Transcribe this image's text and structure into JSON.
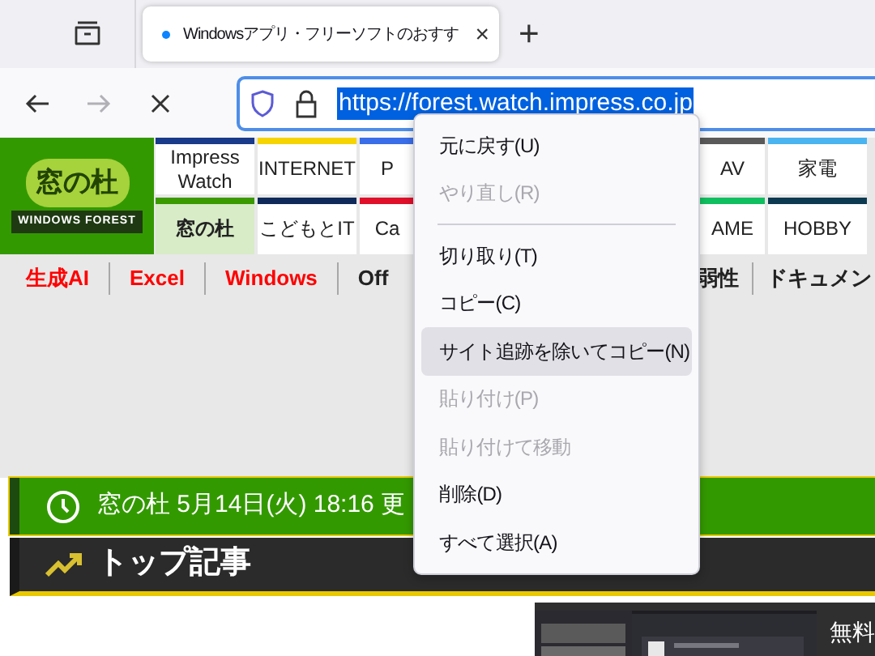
{
  "browser": {
    "tab": {
      "title": "Windowsアプリ・フリーソフトのおすす",
      "loading": true,
      "close": "×"
    },
    "new_tab": "+",
    "nav_buttons": [
      {
        "kind": "back",
        "disabled": false
      },
      {
        "kind": "forward",
        "disabled": true
      },
      {
        "kind": "stop",
        "disabled": false
      }
    ],
    "address": {
      "value": "https://forest.watch.impress.co.jp",
      "selected": true
    }
  },
  "site": {
    "logo": {
      "title": "窓の杜",
      "subtitle": "WINDOWS FOREST"
    },
    "nav_rows": [
      [
        {
          "label": "Impress Watch",
          "color": "#1a3a8a",
          "selected": false
        },
        {
          "label": "INTERNET",
          "color": "#f5d400",
          "selected": false
        },
        {
          "label": "P",
          "color": "#3a6ee8",
          "selected": false
        },
        {
          "label": "AV",
          "color": "#5a5a5a",
          "selected": false
        },
        {
          "label": "家電",
          "color": "#4ab4f0",
          "selected": false
        }
      ],
      [
        {
          "label": "窓の杜",
          "color": "#3a9a00",
          "selected": true
        },
        {
          "label": "こどもとIT",
          "color": "#0f2a5a",
          "selected": false
        },
        {
          "label": "Ca",
          "color": "#e0102a",
          "selected": false
        },
        {
          "label": "AME",
          "color": "#10c060",
          "selected": false
        },
        {
          "label": "HOBBY",
          "color": "#0d3a50",
          "selected": false
        }
      ]
    ],
    "topic_links": {
      "left": [
        {
          "label": "生成AI",
          "kind": "hot"
        },
        {
          "label": "Excel",
          "kind": "hot"
        },
        {
          "label": "Windows",
          "kind": "hot"
        },
        {
          "label": "Off",
          "kind": "plain"
        }
      ],
      "right": [
        {
          "label": "弱性",
          "kind": "plain"
        },
        {
          "label": "ドキュメン",
          "kind": "plain"
        }
      ]
    },
    "update_bar": "窓の杜 5月14日(火) 18:16 更",
    "section_title": "トップ記事",
    "article_teaser": {
      "title": "無料"
    }
  },
  "context_menu": [
    {
      "label": "元に戻す(U)",
      "kind": "item",
      "disabled": false,
      "selected": false
    },
    {
      "label": "やり直し(R)",
      "kind": "item",
      "disabled": true,
      "selected": false
    },
    {
      "kind": "separator"
    },
    {
      "label": "切り取り(T)",
      "kind": "item",
      "disabled": false,
      "selected": false
    },
    {
      "label": "コピー(C)",
      "kind": "item",
      "disabled": false,
      "selected": false
    },
    {
      "label": "サイト追跡を除いてコピー(N)",
      "kind": "item",
      "disabled": false,
      "selected": true
    },
    {
      "label": "貼り付け(P)",
      "kind": "item",
      "disabled": true,
      "selected": false
    },
    {
      "label": "貼り付けて移動",
      "kind": "item",
      "disabled": true,
      "selected": false
    },
    {
      "label": "削除(D)",
      "kind": "item",
      "disabled": false,
      "selected": false
    },
    {
      "label": "すべて選択(A)",
      "kind": "item",
      "disabled": false,
      "selected": false
    }
  ]
}
